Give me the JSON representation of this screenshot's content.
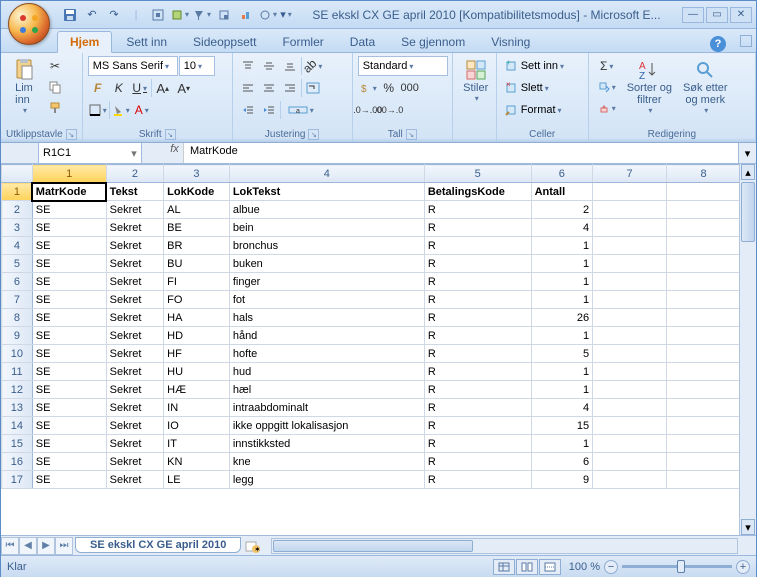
{
  "app": {
    "title": "SE ekskl CX GE april 2010  [Kompatibilitetsmodus] - Microsoft E...",
    "ready": "Klar"
  },
  "tabs": {
    "home": "Hjem",
    "insert": "Sett inn",
    "pagelayout": "Sideoppsett",
    "formulas": "Formler",
    "data": "Data",
    "review": "Se gjennom",
    "view": "Visning"
  },
  "ribbon": {
    "clipboard": {
      "label": "Utklippstavle",
      "paste": "Lim\ninn"
    },
    "font": {
      "label": "Skrift",
      "name": "MS Sans Serif",
      "size": "10"
    },
    "alignment": {
      "label": "Justering"
    },
    "number": {
      "label": "Tall",
      "format": "Standard"
    },
    "styles": {
      "label": "Stiler"
    },
    "cells": {
      "label": "Celler",
      "insert": "Sett inn",
      "delete": "Slett",
      "format": "Format"
    },
    "editing": {
      "label": "Redigering",
      "sort": "Sorter og\nfiltrer",
      "find": "Søk etter\nog merk"
    }
  },
  "namebox": "R1C1",
  "formula": "MatrKode",
  "sheet": {
    "tab": "SE ekskl CX GE april 2010",
    "cols": [
      "1",
      "2",
      "3",
      "4",
      "5",
      "6",
      "7",
      "8"
    ],
    "headers": [
      "MatrKode",
      "Tekst",
      "LokKode",
      "LokTekst",
      "BetalingsKode",
      "Antall",
      "",
      ""
    ],
    "rows": [
      [
        "SE",
        "Sekret",
        "AL",
        "albue",
        "R",
        "2",
        "",
        ""
      ],
      [
        "SE",
        "Sekret",
        "BE",
        "bein",
        "R",
        "4",
        "",
        ""
      ],
      [
        "SE",
        "Sekret",
        "BR",
        "bronchus",
        "R",
        "1",
        "",
        ""
      ],
      [
        "SE",
        "Sekret",
        "BU",
        "buken",
        "R",
        "1",
        "",
        ""
      ],
      [
        "SE",
        "Sekret",
        "FI",
        "finger",
        "R",
        "1",
        "",
        ""
      ],
      [
        "SE",
        "Sekret",
        "FO",
        "fot",
        "R",
        "1",
        "",
        ""
      ],
      [
        "SE",
        "Sekret",
        "HA",
        "hals",
        "R",
        "26",
        "",
        ""
      ],
      [
        "SE",
        "Sekret",
        "HD",
        "hånd",
        "R",
        "1",
        "",
        ""
      ],
      [
        "SE",
        "Sekret",
        "HF",
        "hofte",
        "R",
        "5",
        "",
        ""
      ],
      [
        "SE",
        "Sekret",
        "HU",
        "hud",
        "R",
        "1",
        "",
        ""
      ],
      [
        "SE",
        "Sekret",
        "HÆ",
        "hæl",
        "R",
        "1",
        "",
        ""
      ],
      [
        "SE",
        "Sekret",
        "IN",
        "intraabdominalt",
        "R",
        "4",
        "",
        ""
      ],
      [
        "SE",
        "Sekret",
        "IO",
        "ikke oppgitt lokalisasjon",
        "R",
        "15",
        "",
        ""
      ],
      [
        "SE",
        "Sekret",
        "IT",
        "innstikksted",
        "R",
        "1",
        "",
        ""
      ],
      [
        "SE",
        "Sekret",
        "KN",
        "kne",
        "R",
        "6",
        "",
        ""
      ],
      [
        "SE",
        "Sekret",
        "LE",
        "legg",
        "R",
        "9",
        "",
        ""
      ]
    ]
  },
  "zoom": "100 %"
}
